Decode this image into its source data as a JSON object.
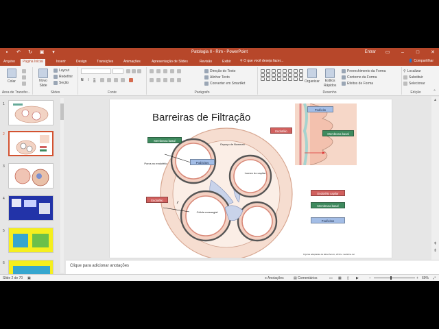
{
  "app": {
    "title": "Patologia II - Rim - PowerPoint",
    "enter": "Entrar",
    "share": "Compartilhar",
    "tellme": "O que você deseja fazer..."
  },
  "tabs": [
    "Arquivo",
    "Página Inicial",
    "Inserir",
    "Design",
    "Transições",
    "Animações",
    "Apresentação de Slides",
    "Revisão",
    "Exibir"
  ],
  "ribbon": {
    "clipboard": {
      "paste": "Colar",
      "group": "Área de Transfer..."
    },
    "slides": {
      "new_slide_1": "Novo",
      "new_slide_2": "Slide",
      "layout": "Layout",
      "reset": "Redefinir",
      "section": "Seção",
      "group": "Slides"
    },
    "font": {
      "group": "Fonte"
    },
    "paragraph": {
      "direction": "Direção do Texto",
      "align": "Alinhar Texto",
      "smartart": "Converter em SmartArt",
      "group": "Parágrafo"
    },
    "drawing": {
      "arrange": "Organizar",
      "styles_1": "Estilos",
      "styles_2": "Rápidos",
      "fill": "Preenchimento da Forma",
      "outline": "Contorno da Forma",
      "effects": "Efeitos de Forma",
      "group": "Desenho"
    },
    "editing": {
      "find": "Localizar",
      "replace": "Substituir",
      "select": "Selecionar",
      "group": "Edição"
    }
  },
  "slide_numbers": [
    "1",
    "2",
    "3",
    "4",
    "5",
    "6"
  ],
  "slide": {
    "title": "Barreiras de Filtração",
    "labels": {
      "espaco": "Espaço de Bowman",
      "poros": "Poros no endotélio",
      "lumen": "Lumen do capilar",
      "celula": "Célula mesangial"
    },
    "tags": {
      "membrana": "Membrana basal",
      "podocitos": "Podócitos",
      "endotelio": "Endotélio"
    },
    "inset_tags": {
      "podocito": "Podócito",
      "endotelio": "Endotélio",
      "membrana": "Membrana basal"
    },
    "legend": {
      "endotelio": "Endotélio capilar",
      "membrana": "Membrana basal",
      "podocitos": "Podócitos"
    },
    "caption": "Figuras adaptadas de Eknerherum, 2010 e medicina.net"
  },
  "notes": {
    "placeholder": "Clique para adicionar anotações"
  },
  "status": {
    "slide": "Slide 2 de 70",
    "notes": "Anotações",
    "comments": "Comentários",
    "zoom": "69%"
  },
  "colors": {
    "accent": "#b7472a",
    "tag_green": "#3e8a5e",
    "tag_blue": "#a3bde6",
    "tag_red": "#d1605e"
  }
}
